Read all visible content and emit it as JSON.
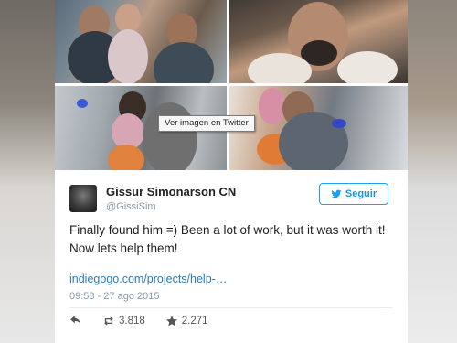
{
  "tooltip": {
    "text": "Ver imagen en Twitter"
  },
  "tweet": {
    "author_name": "Gissur Simonarson CN",
    "author_handle": "@GissiSim",
    "follow_label": "Seguir",
    "text_lines": [
      "Finally found him =) Been a lot of work, but it was worth it!",
      "Now lets help them!"
    ],
    "link": "indiegogo.com/projects/help-…",
    "timestamp": "09:58 - 27 ago 2015",
    "retweets": "3.818",
    "likes": "2.271"
  },
  "colors": {
    "twitter_blue": "#1da1f2",
    "link_blue": "#2b7bb9",
    "meta_gray": "#8899a6"
  },
  "icons": [
    "twitter-bird-icon",
    "reply-icon",
    "retweet-icon",
    "star-icon"
  ]
}
